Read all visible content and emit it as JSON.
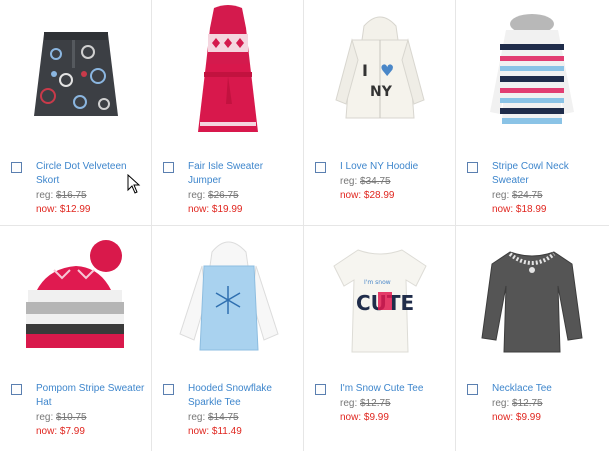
{
  "products": [
    {
      "name": "Circle Dot Velveteen Skort",
      "reg_label": "reg: ",
      "reg_price": "$16.75",
      "now_label": "now: ",
      "now_price": "$12.99",
      "icon": "skort-image"
    },
    {
      "name": "Fair Isle Sweater Jumper",
      "reg_label": "reg: ",
      "reg_price": "$26.75",
      "now_label": "now: ",
      "now_price": "$19.99",
      "icon": "sweater-jumper-image"
    },
    {
      "name": "I Love NY Hoodie",
      "reg_label": "reg: ",
      "reg_price": "$34.75",
      "now_label": "now: ",
      "now_price": "$28.99",
      "icon": "hoodie-image"
    },
    {
      "name": "Stripe Cowl Neck Sweater",
      "reg_label": "reg: ",
      "reg_price": "$24.75",
      "now_label": "now: ",
      "now_price": "$18.99",
      "icon": "stripe-sweater-image"
    },
    {
      "name": "Pompom Stripe Sweater Hat",
      "reg_label": "reg: ",
      "reg_price": "$10.75",
      "now_label": "now: ",
      "now_price": "$7.99",
      "icon": "pompom-hat-image"
    },
    {
      "name": "Hooded Snowflake Sparkle Tee",
      "reg_label": "reg: ",
      "reg_price": "$14.75",
      "now_label": "now: ",
      "now_price": "$11.49",
      "icon": "snowflake-tee-image"
    },
    {
      "name": "I'm Snow Cute Tee",
      "reg_label": "reg: ",
      "reg_price": "$12.75",
      "now_label": "now: ",
      "now_price": "$9.99",
      "icon": "snow-cute-tee-image",
      "print_small": "I'm snow",
      "print_big": "CUTE"
    },
    {
      "name": "Necklace Tee",
      "reg_label": "reg: ",
      "reg_price": "$12.75",
      "now_label": "now: ",
      "now_price": "$9.99",
      "icon": "necklace-tee-image"
    }
  ],
  "hoodie_print": {
    "top": "I",
    "heart": "♥",
    "bottom": "NY"
  },
  "colors": {
    "link": "#3e86cc",
    "sale": "#e0261f",
    "reg": "#777777",
    "checkbox_border": "#5a7fb0"
  }
}
